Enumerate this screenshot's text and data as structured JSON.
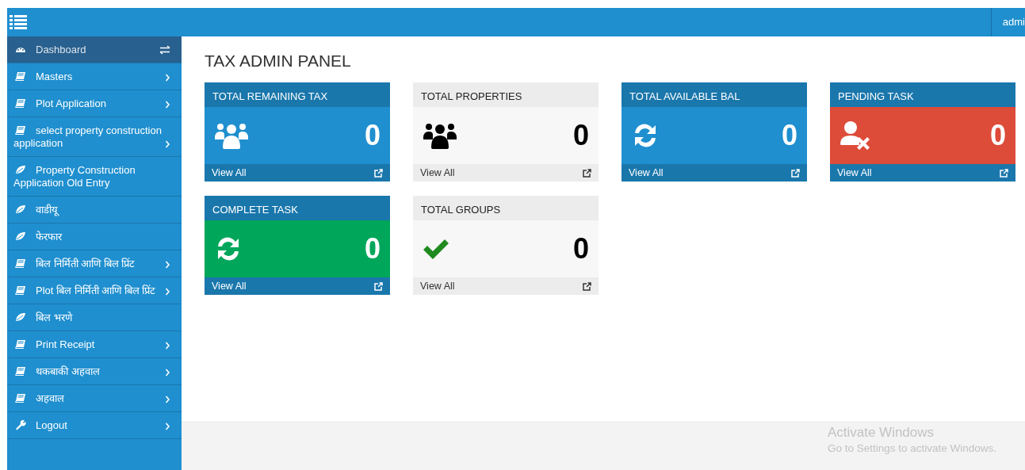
{
  "topbar": {
    "user": "admi"
  },
  "sidebar": {
    "items": [
      {
        "label": "Dashboard",
        "kind": "dashboard",
        "switch": true,
        "submenu": false,
        "selected": true
      },
      {
        "label": "Masters",
        "kind": "book",
        "switch": false,
        "submenu": true,
        "selected": false
      },
      {
        "label": "Plot Application",
        "kind": "book",
        "switch": false,
        "submenu": true,
        "selected": false
      },
      {
        "label": "select property construction application",
        "kind": "book",
        "switch": false,
        "submenu": true,
        "selected": false
      },
      {
        "label": "Property Construction Application Old Entry",
        "kind": "leaf",
        "switch": false,
        "submenu": false,
        "selected": false
      },
      {
        "label": "वाडीयू",
        "kind": "leaf",
        "switch": false,
        "submenu": false,
        "selected": false
      },
      {
        "label": "फेरफार",
        "kind": "leaf",
        "switch": false,
        "submenu": false,
        "selected": false
      },
      {
        "label": "बिल निर्मिती आणि बिल प्रिंट",
        "kind": "book",
        "switch": false,
        "submenu": true,
        "selected": false
      },
      {
        "label": "Plot बिल निर्मिती आणि बिल प्रिंट",
        "kind": "book",
        "switch": false,
        "submenu": true,
        "selected": false
      },
      {
        "label": "बिल भरणे",
        "kind": "leaf",
        "switch": false,
        "submenu": false,
        "selected": false
      },
      {
        "label": "Print Receipt",
        "kind": "book",
        "switch": false,
        "submenu": true,
        "selected": false
      },
      {
        "label": "थकबाकी अहवाल",
        "kind": "book",
        "switch": false,
        "submenu": true,
        "selected": false
      },
      {
        "label": "अहवाल",
        "kind": "book",
        "switch": false,
        "submenu": true,
        "selected": false
      },
      {
        "label": "Logout",
        "kind": "wrench",
        "switch": false,
        "submenu": true,
        "selected": false
      }
    ]
  },
  "page_title": "TAX ADMIN PANEL",
  "cards": [
    {
      "title": "TOTAL REMAINING TAX",
      "value": "0",
      "link": "View All",
      "color": "#1f8fcf",
      "kind": "users"
    },
    {
      "title": "TOTAL PROPERTIES",
      "value": "0",
      "link": "View All",
      "color": "#f7f7f7",
      "kind": "users"
    },
    {
      "title": "TOTAL AVAILABLE BAL",
      "value": "0",
      "link": "View All",
      "color": "#1f8fcf",
      "kind": "refresh"
    },
    {
      "title": "PENDING TASK",
      "value": "0",
      "link": "View All",
      "color": "#dd4b39",
      "kind": "user-x"
    },
    {
      "title": "COMPLETE TASK",
      "value": "0",
      "link": "View All",
      "color": "#00a65a",
      "kind": "refresh"
    },
    {
      "title": "TOTAL GROUPS",
      "value": "0",
      "link": "View All",
      "color": "#f7f7f7",
      "kind": "check"
    }
  ],
  "os_notice": {
    "title": "Activate Windows",
    "text": "Go to Settings to activate Windows."
  }
}
